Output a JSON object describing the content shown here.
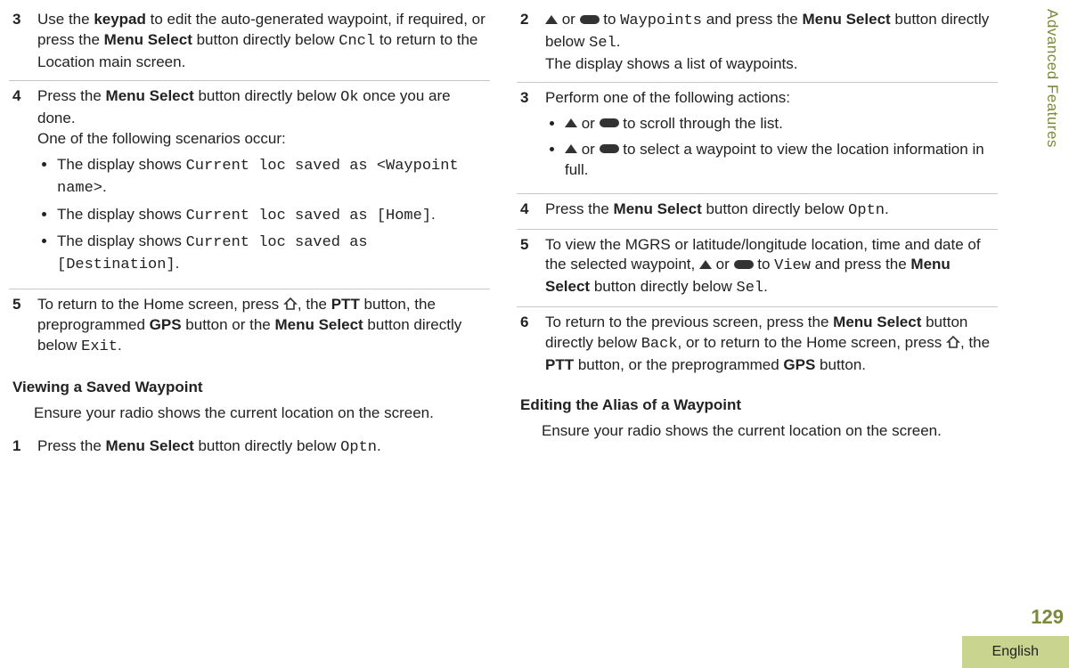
{
  "sidebar": "Advanced Features",
  "pagenum": "129",
  "language": "English",
  "col1": {
    "step3": {
      "num": "3",
      "t1": "Use the ",
      "b1": "keypad",
      "t2": " to edit the auto-generated waypoint, if required, or press the ",
      "b2": "Menu Select",
      "t3": " button directly below ",
      "m1": "Cncl",
      "t4": " to return to the Location main screen."
    },
    "step4": {
      "num": "4",
      "t1": "Press the ",
      "b1": "Menu Select",
      "t2": " button directly below ",
      "m1": "Ok",
      "t3": " once you are done.",
      "t4": "One of the following scenarios occur:",
      "b_items": {
        "i1a": "The display shows ",
        "i1m": "Current loc saved as <Waypoint name>",
        "dot1": ".",
        "i2a": "The display shows ",
        "i2m": "Current loc saved as [Home]",
        "dot2": ".",
        "i3a": "The display shows ",
        "i3m": "Current loc saved as [Destination]",
        "dot3": "."
      }
    },
    "step5": {
      "num": "5",
      "t1": "To return to the Home screen, press ",
      "t2": ", the ",
      "b1": "PTT",
      "t3": " button, the preprogrammed ",
      "b2": "GPS",
      "t4": " button or the ",
      "b3": "Menu Select",
      "t5": " button directly below ",
      "m1": "Exit",
      "dot": "."
    },
    "heading": "Viewing a Saved Waypoint",
    "intro": "Ensure your radio shows the current location on the screen.",
    "step1b": {
      "num": "1",
      "t1": "Press the ",
      "b1": "Menu Select",
      "t2": " button directly below ",
      "m1": "Optn",
      "dot": "."
    }
  },
  "col2": {
    "step2": {
      "num": "2",
      "t1": " or ",
      "t2": " to ",
      "m1": "Waypoints",
      "t3": " and press the ",
      "b1": "Menu Select",
      "t4": " button directly below ",
      "m2": "Sel",
      "dot": ".",
      "t5": "The display shows a list of waypoints."
    },
    "step3": {
      "num": "3",
      "t1": "Perform one of the following actions:",
      "items": {
        "i1a": " or ",
        "i1b": " to scroll through the list.",
        "i2a": " or ",
        "i2b": " to select a waypoint to view the location information in full."
      }
    },
    "step4": {
      "num": "4",
      "t1": "Press the ",
      "b1": "Menu Select",
      "t2": " button directly below ",
      "m1": "Optn",
      "dot": "."
    },
    "step5": {
      "num": "5",
      "t1": "To view the MGRS or latitude/longitude location, time and date of the selected waypoint, ",
      "t2": " or ",
      "t3": " to ",
      "m1": "View",
      "t4": " and press the ",
      "b1": "Menu Select",
      "t5": " button directly below ",
      "m2": "Sel",
      "dot": "."
    },
    "step6": {
      "num": "6",
      "t1": "To return to the previous screen, press the ",
      "b1": "Menu Select",
      "t2": " button directly below ",
      "m1": "Back",
      "t3": ", or to return to the Home screen, press ",
      "t4": ", the ",
      "b2": "PTT",
      "t5": " button, or the preprogrammed ",
      "b3": "GPS",
      "t6": " button."
    },
    "heading": "Editing the Alias of a Waypoint",
    "intro": "Ensure your radio shows the current location on the screen."
  }
}
